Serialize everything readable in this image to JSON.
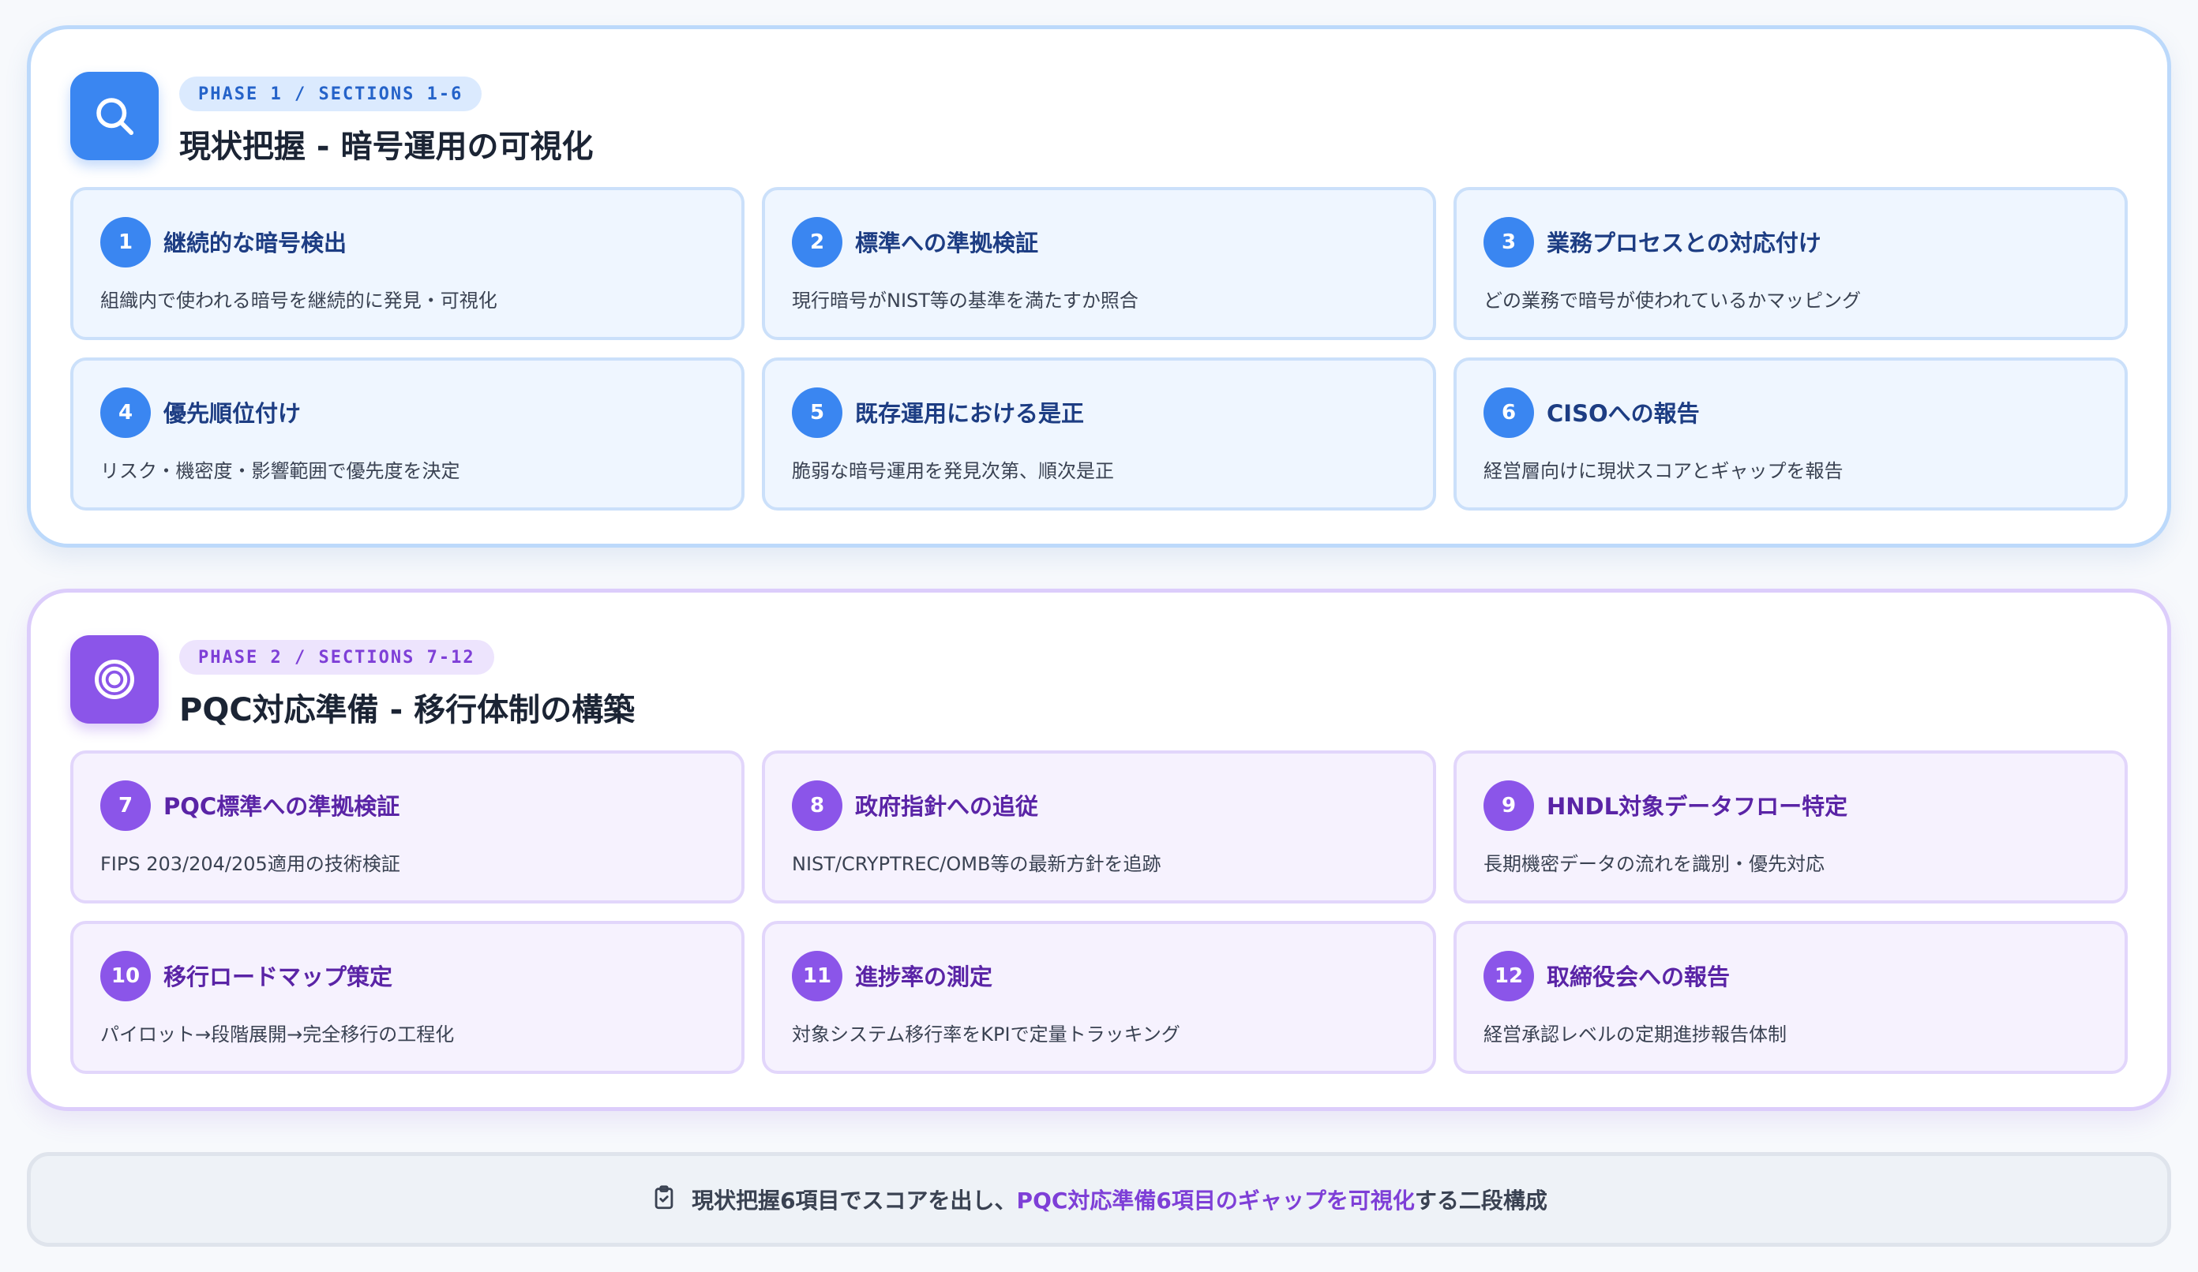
{
  "phase1": {
    "badge": "PHASE 1 / SECTIONS 1-6",
    "title": "現状把握 - 暗号運用の可視化",
    "icon": "search-icon",
    "accent": "#3a86f1",
    "items": [
      {
        "num": "1",
        "title": "継続的な暗号検出",
        "desc": "組織内で使われる暗号を継続的に発見・可視化"
      },
      {
        "num": "2",
        "title": "標準への準拠検証",
        "desc": "現行暗号がNIST等の基準を満たすか照合"
      },
      {
        "num": "3",
        "title": "業務プロセスとの対応付け",
        "desc": "どの業務で暗号が使われているかマッピング"
      },
      {
        "num": "4",
        "title": "優先順位付け",
        "desc": "リスク・機密度・影響範囲で優先度を決定"
      },
      {
        "num": "5",
        "title": "既存運用における是正",
        "desc": "脆弱な暗号運用を発見次第、順次是正"
      },
      {
        "num": "6",
        "title": "CISOへの報告",
        "desc": "経営層向けに現状スコアとギャップを報告"
      }
    ]
  },
  "phase2": {
    "badge": "PHASE 2 / SECTIONS 7-12",
    "title": "PQC対応準備 - 移行体制の構築",
    "icon": "target-icon",
    "accent": "#8b55e9",
    "items": [
      {
        "num": "7",
        "title": "PQC標準への準拠検証",
        "desc": "FIPS 203/204/205適用の技術検証"
      },
      {
        "num": "8",
        "title": "政府指針への追従",
        "desc": "NIST/CRYPTREC/OMB等の最新方針を追跡"
      },
      {
        "num": "9",
        "title": "HNDL対象データフロー特定",
        "desc": "長期機密データの流れを識別・優先対応"
      },
      {
        "num": "10",
        "title": "移行ロードマップ策定",
        "desc": "パイロット→段階展開→完全移行の工程化"
      },
      {
        "num": "11",
        "title": "進捗率の測定",
        "desc": "対象システム移行率をKPIで定量トラッキング"
      },
      {
        "num": "12",
        "title": "取締役会への報告",
        "desc": "経営承認レベルの定期進捗報告体制"
      }
    ]
  },
  "footer": {
    "icon": "clipboard-check-icon",
    "text_before": "現状把握6項目でスコアを出し、",
    "text_highlight": "PQC対応準備6項目のギャップを可視化",
    "text_after": "する二段構成"
  }
}
